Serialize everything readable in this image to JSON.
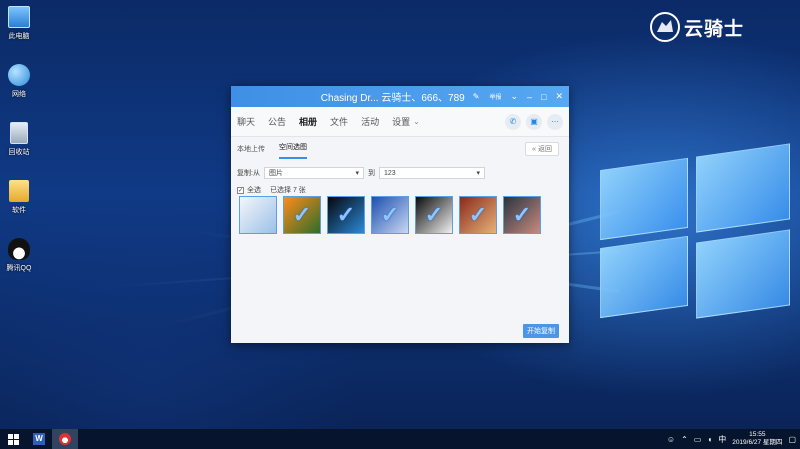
{
  "desktop": {
    "icons": [
      {
        "label": "此电脑"
      },
      {
        "label": "网络"
      },
      {
        "label": "回收站"
      },
      {
        "label": "软件"
      },
      {
        "label": "腾讯QQ"
      }
    ],
    "watermark": "云骑士"
  },
  "window": {
    "title": "Chasing Dr...  云骑士、666、789",
    "controls": {
      "mode": "举报",
      "minimize": "–",
      "maximize": "□",
      "close": "✕"
    },
    "tabs": [
      "聊天",
      "公告",
      "相册",
      "文件",
      "活动",
      "设置"
    ],
    "active_tab": "相册",
    "subtabs": [
      "本地上传",
      "空间选图"
    ],
    "active_subtab": "空间选图",
    "back_label": "返回",
    "copy": {
      "from_label": "复制:从",
      "from_value": "图片",
      "to_label": "到",
      "to_value": "123"
    },
    "select_all": "全选",
    "selected_count": "已选择 7 张",
    "thumbnails": [
      {
        "name": "photo-1",
        "colors": [
          "#f4f6f9",
          "#9bc0e8"
        ],
        "checked": false
      },
      {
        "name": "photo-2",
        "colors": [
          "#ff8c1a",
          "#2d6d2a"
        ],
        "checked": true
      },
      {
        "name": "photo-3",
        "colors": [
          "#05070c",
          "#2b8ad8"
        ],
        "checked": true
      },
      {
        "name": "photo-4",
        "colors": [
          "#1d4fb0",
          "#c9d8f2"
        ],
        "checked": true
      },
      {
        "name": "photo-5",
        "colors": [
          "#0c0c0c",
          "#f1f1f1"
        ],
        "checked": true
      },
      {
        "name": "photo-6",
        "colors": [
          "#8a2a1a",
          "#e7b27a"
        ],
        "checked": true
      },
      {
        "name": "photo-7",
        "colors": [
          "#2a3440",
          "#c78a80"
        ],
        "checked": true
      }
    ],
    "start_button": "开始复制"
  },
  "taskbar": {
    "time": "15:55",
    "date": "2019/6/27 星期四",
    "ime": "中"
  },
  "colors": {
    "accent": "#3f8fe6",
    "taskbar": "#06142e"
  }
}
